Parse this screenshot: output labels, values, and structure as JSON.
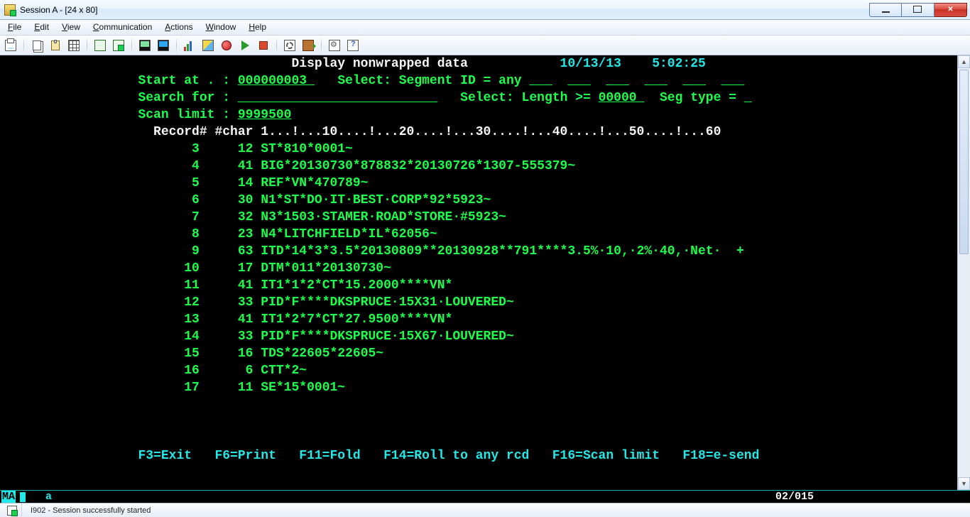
{
  "window": {
    "title": "Session A - [24 x 80]"
  },
  "menu": {
    "items": [
      {
        "label": "File",
        "accel_index": 0
      },
      {
        "label": "Edit",
        "accel_index": 0
      },
      {
        "label": "View",
        "accel_index": 0
      },
      {
        "label": "Communication",
        "accel_index": 0
      },
      {
        "label": "Actions",
        "accel_index": 0
      },
      {
        "label": "Window",
        "accel_index": 0
      },
      {
        "label": "Help",
        "accel_index": 0
      }
    ]
  },
  "toolbar": {
    "buttons": [
      "print",
      "|",
      "copy",
      "paste",
      "grid",
      "|",
      "connect",
      "disconnect",
      "|",
      "display-green",
      "display-blue",
      "|",
      "chart",
      "color-picker",
      "record",
      "play",
      "stop",
      "|",
      "macro-settings",
      "door",
      "|",
      "settings",
      "help"
    ]
  },
  "screen": {
    "title": "Display nonwrapped data",
    "date": "10/13/13",
    "time": "5:02:25",
    "start_at": {
      "label": "Start at . :",
      "value": "000000003 "
    },
    "select_seg": {
      "label": "Select: Segment ID = any"
    },
    "search_for": {
      "label": "Search for :",
      "value": "                          "
    },
    "select_len": {
      "label": "Select: Length >=",
      "value": "00000 "
    },
    "seg_type": {
      "label": "Seg type ="
    },
    "scan_limit": {
      "label": "Scan limit :",
      "value": "9999500"
    },
    "ruler": "  Record# #char 1...!...10....!...20....!...30....!...40....!...50....!...60",
    "rows": [
      {
        "rec": "3",
        "nc": "12",
        "data": "ST*810*0001~"
      },
      {
        "rec": "4",
        "nc": "41",
        "data": "BIG*20130730*878832*20130726*1307-555379~"
      },
      {
        "rec": "5",
        "nc": "14",
        "data": "REF*VN*470789~"
      },
      {
        "rec": "6",
        "nc": "30",
        "data": "N1*ST*DO·IT·BEST·CORP*92*5923~"
      },
      {
        "rec": "7",
        "nc": "32",
        "data": "N3*1503·STAMER·ROAD*STORE·#5923~"
      },
      {
        "rec": "8",
        "nc": "23",
        "data": "N4*LITCHFIELD*IL*62056~"
      },
      {
        "rec": "9",
        "nc": "63",
        "data": "ITD*14*3*3.5*20130809**20130928**791****3.5%·10,·2%·40,·Net·  +"
      },
      {
        "rec": "10",
        "nc": "17",
        "data": "DTM*011*20130730~"
      },
      {
        "rec": "11",
        "nc": "41",
        "data": "IT1*1*2*CT*15.2000****VN*"
      },
      {
        "rec": "12",
        "nc": "33",
        "data": "PID*F****DKSPRUCE·15X31·LOUVERED~"
      },
      {
        "rec": "13",
        "nc": "41",
        "data": "IT1*2*7*CT*27.9500****VN*"
      },
      {
        "rec": "14",
        "nc": "33",
        "data": "PID*F****DKSPRUCE·15X67·LOUVERED~"
      },
      {
        "rec": "15",
        "nc": "16",
        "data": "TDS*22605*22605~"
      },
      {
        "rec": "16",
        "nc": "6",
        "data": "CTT*2~"
      },
      {
        "rec": "17",
        "nc": "11",
        "data": "SE*15*0001~"
      }
    ],
    "fkeys_line": "F3=Exit   F6=Print   F11=Fold   F14=Roll to any rcd   F16=Scan limit   F18=e-send",
    "fkeys": [
      {
        "key": "F3",
        "label": "Exit"
      },
      {
        "key": "F6",
        "label": "Print"
      },
      {
        "key": "F11",
        "label": "Fold"
      },
      {
        "key": "F14",
        "label": "Roll to any rcd"
      },
      {
        "key": "F16",
        "label": "Scan limit"
      },
      {
        "key": "F18",
        "label": "e-send"
      }
    ]
  },
  "oia": {
    "status": "MA",
    "input": "a",
    "cursor_pos": "02/015"
  },
  "statusbar": {
    "msg": "I902 - Session successfully started"
  }
}
